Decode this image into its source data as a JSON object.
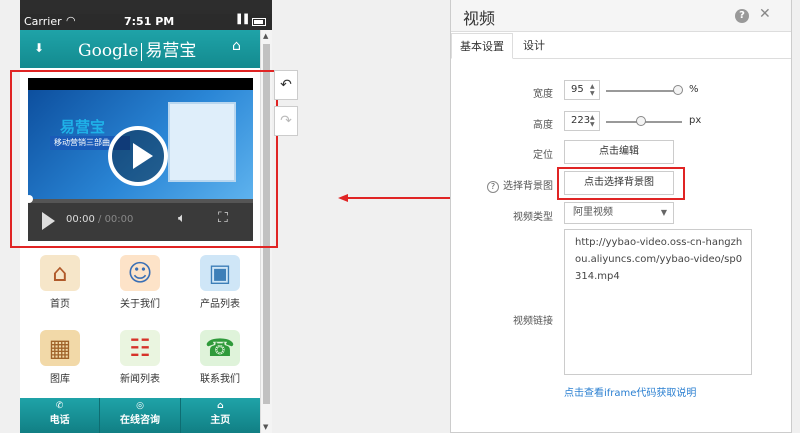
{
  "phone": {
    "statusbar": {
      "carrier": "Carrier",
      "time": "7:51 PM"
    },
    "header": {
      "logo_google": "Google",
      "logo_brand": "易营宝"
    },
    "video": {
      "poster_brand": "易营宝",
      "poster_tagline": "移动营销三部曲",
      "current_time": "00:00",
      "duration": "/ 00:00"
    },
    "grid": [
      {
        "label": "首页",
        "icon": "house-icon"
      },
      {
        "label": "关于我们",
        "icon": "people-icon"
      },
      {
        "label": "产品列表",
        "icon": "monitor-icon"
      },
      {
        "label": "图库",
        "icon": "gallery-icon"
      },
      {
        "label": "新闻列表",
        "icon": "calendar-icon"
      },
      {
        "label": "联系我们",
        "icon": "telephone-icon"
      }
    ],
    "footer": [
      {
        "label": "电话",
        "icon": "phone-icon"
      },
      {
        "label": "在线咨询",
        "icon": "chat-icon"
      },
      {
        "label": "主页",
        "icon": "home-icon"
      }
    ]
  },
  "panel": {
    "title": "视频",
    "tabs": [
      "基本设置",
      "设计"
    ],
    "width": {
      "label": "宽度",
      "value": "95",
      "unit": "%",
      "percent": 95
    },
    "height": {
      "label": "高度",
      "value": "223",
      "unit": "px"
    },
    "position": {
      "label": "定位",
      "button": "点击编辑"
    },
    "background": {
      "label": "选择背景图",
      "button": "点击选择背景图"
    },
    "video_type": {
      "label": "视频类型",
      "selected": "阿里视频"
    },
    "video_link": {
      "label": "视频链接",
      "value": "http://yybao-video.oss-cn-hangzhou.aliyuncs.com/yybao-video/sp0314.mp4"
    },
    "iframe_link": "点击查看iframe代码获取说明"
  },
  "colors": {
    "accent": "#1a9aa0",
    "highlight": "#e02424",
    "link": "#2a7fd1"
  }
}
